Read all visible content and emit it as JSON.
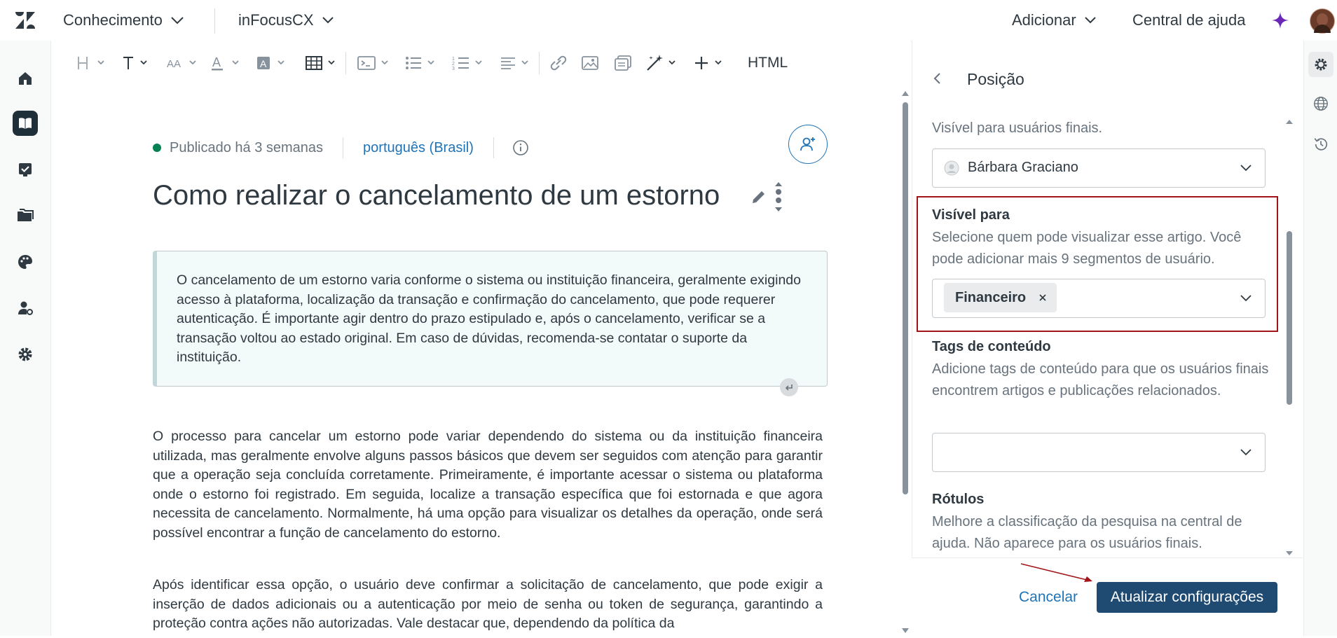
{
  "header": {
    "product": "Conhecimento",
    "brand": "inFocusCX",
    "add_label": "Adicionar",
    "help_center_label": "Central de ajuda"
  },
  "toolbar": {
    "html_label": "HTML"
  },
  "article": {
    "status": "Publicado há 3 semanas",
    "locale": "português (Brasil)",
    "title": "Como realizar o cancelamento de um estorno",
    "summary": "O cancelamento de um estorno varia conforme o sistema ou instituição financeira, geralmente exigindo acesso à plataforma, localização da transação e confirmação do cancelamento, que pode requerer autenticação. É importante agir dentro do prazo estipulado e, após o cancelamento, verificar se a transação voltou ao estado original. Em caso de dúvidas, recomenda-se contatar o suporte da instituição.",
    "paragraph1": "O processo para cancelar um estorno pode variar dependendo do sistema ou da instituição financeira utilizada, mas geralmente envolve alguns passos básicos que devem ser seguidos com atenção para garantir que a operação seja concluída corretamente. Primeiramente, é importante acessar o sistema ou plataforma onde o estorno foi registrado. Em seguida, localize a transação específica que foi estornada e que agora necessita de cancelamento. Normalmente, há uma opção para visualizar os detalhes da operação, onde será possível encontrar a função de cancelamento do estorno.",
    "paragraph2": "Após identificar essa opção, o usuário deve confirmar a solicitação de cancelamento, que pode exigir a inserção de dados adicionais ou a autenticação por meio de senha ou token de segurança, garantindo a proteção contra ações não autorizadas. Vale destacar que, dependendo da política da"
  },
  "panel": {
    "title": "Posição",
    "visible_end_users_text": "Visível para usuários finais.",
    "owner_value": "Bárbara Graciano",
    "visible_for": {
      "label": "Visível para",
      "hint": "Selecione quem pode visualizar esse artigo. Você pode adicionar mais 9 segmentos de usuário.",
      "tag": "Financeiro"
    },
    "content_tags": {
      "label": "Tags de conteúdo",
      "hint": "Adicione tags de conteúdo para que os usuários finais encontrem artigos e publicações relacionados."
    },
    "labels": {
      "label": "Rótulos",
      "hint": "Melhore a classificação da pesquisa na central de ajuda. Não aparece para os usuários finais."
    },
    "cancel_label": "Cancelar",
    "update_label": "Atualizar configurações"
  },
  "colors": {
    "primary": "#1f4b73",
    "link": "#1f73b7",
    "highlight": "#a1151a",
    "published": "#038153"
  }
}
